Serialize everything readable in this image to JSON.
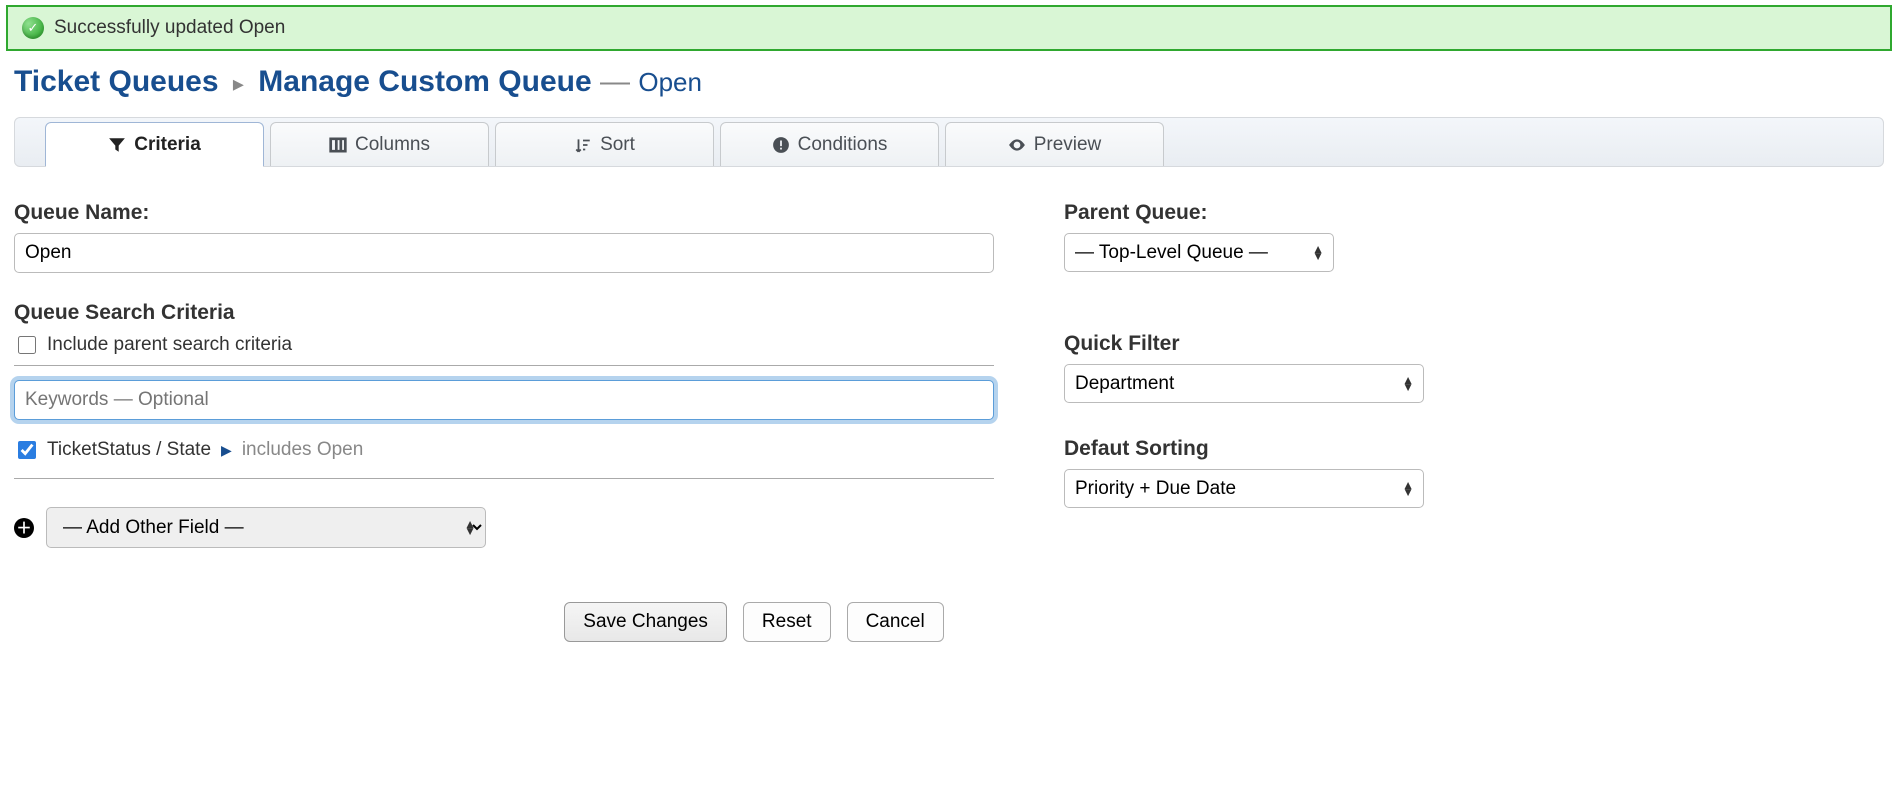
{
  "alert": {
    "message": "Successfully updated Open"
  },
  "title": {
    "crumb": "Ticket Queues",
    "page": "Manage Custom Queue",
    "sep": "—",
    "suffix": "Open"
  },
  "tabs": {
    "criteria": "Criteria",
    "columns": "Columns",
    "sort": "Sort",
    "conditions": "Conditions",
    "preview": "Preview"
  },
  "form": {
    "queueNameLabel": "Queue Name:",
    "queueName": "Open",
    "criteriaLabel": "Queue Search Criteria",
    "includeParent": "Include parent search criteria",
    "keywordsPlaceholder": "Keywords — Optional",
    "criterion": {
      "field": "TicketStatus / State",
      "op": "includes Open"
    },
    "addOther": "— Add Other Field —"
  },
  "side": {
    "parentLabel": "Parent Queue:",
    "parentValue": "— Top-Level Queue —",
    "quickFilterLabel": "Quick Filter",
    "quickFilterValue": "Department",
    "defaultSortLabel": "Defaut Sorting",
    "defaultSortValue": "Priority + Due Date"
  },
  "buttons": {
    "save": "Save Changes",
    "reset": "Reset",
    "cancel": "Cancel"
  }
}
